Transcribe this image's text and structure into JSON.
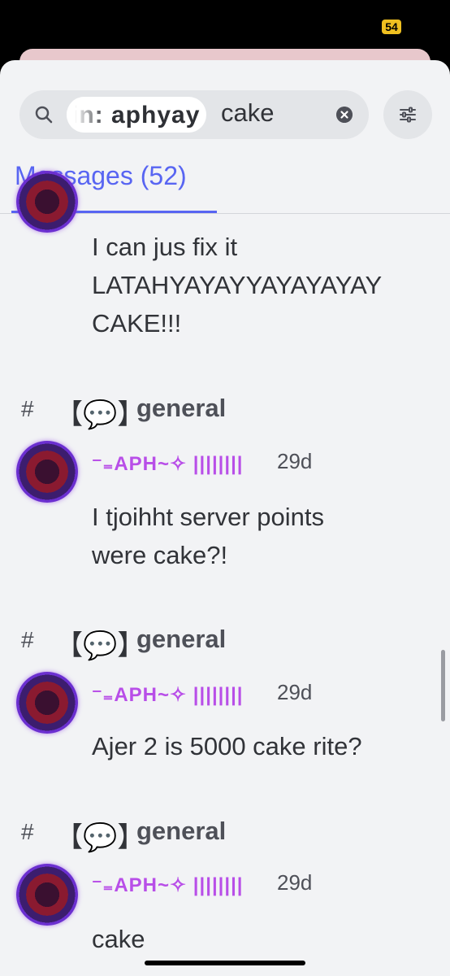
{
  "status_bar": {
    "battery_label": "54"
  },
  "search": {
    "chip_text": "in: aphyay",
    "query": "cake"
  },
  "tabs": [
    {
      "label": "Messages (52)"
    }
  ],
  "results": [
    {
      "lines": [
        "I can jus fix it",
        "LATAHYAYAYYAYAYAYAY",
        "CAKE!!!"
      ]
    },
    {
      "channel": {
        "hash": "#",
        "emoji": "【💬】",
        "name": "general"
      },
      "author": "⁻₌APH~✧ ||||||||",
      "time": "29d",
      "lines": [
        "I tjoihht server points",
        "were cake?!"
      ]
    },
    {
      "channel": {
        "hash": "#",
        "emoji": "【💬】",
        "name": "general"
      },
      "author": "⁻₌APH~✧ ||||||||",
      "time": "29d",
      "lines": [
        "Ajer 2 is 5000 cake rite?"
      ]
    },
    {
      "channel": {
        "hash": "#",
        "emoji": "【💬】",
        "name": "general"
      },
      "author": "⁻₌APH~✧ ||||||||",
      "time": "29d",
      "lines": [
        "cake"
      ]
    }
  ],
  "icons": {
    "search": "search-icon",
    "clear": "close-circle-icon",
    "filter": "sliders-icon"
  },
  "colors": {
    "accent": "#5865f2",
    "username": "#b84ee8",
    "text": "#313338",
    "background": "#f2f3f5"
  }
}
